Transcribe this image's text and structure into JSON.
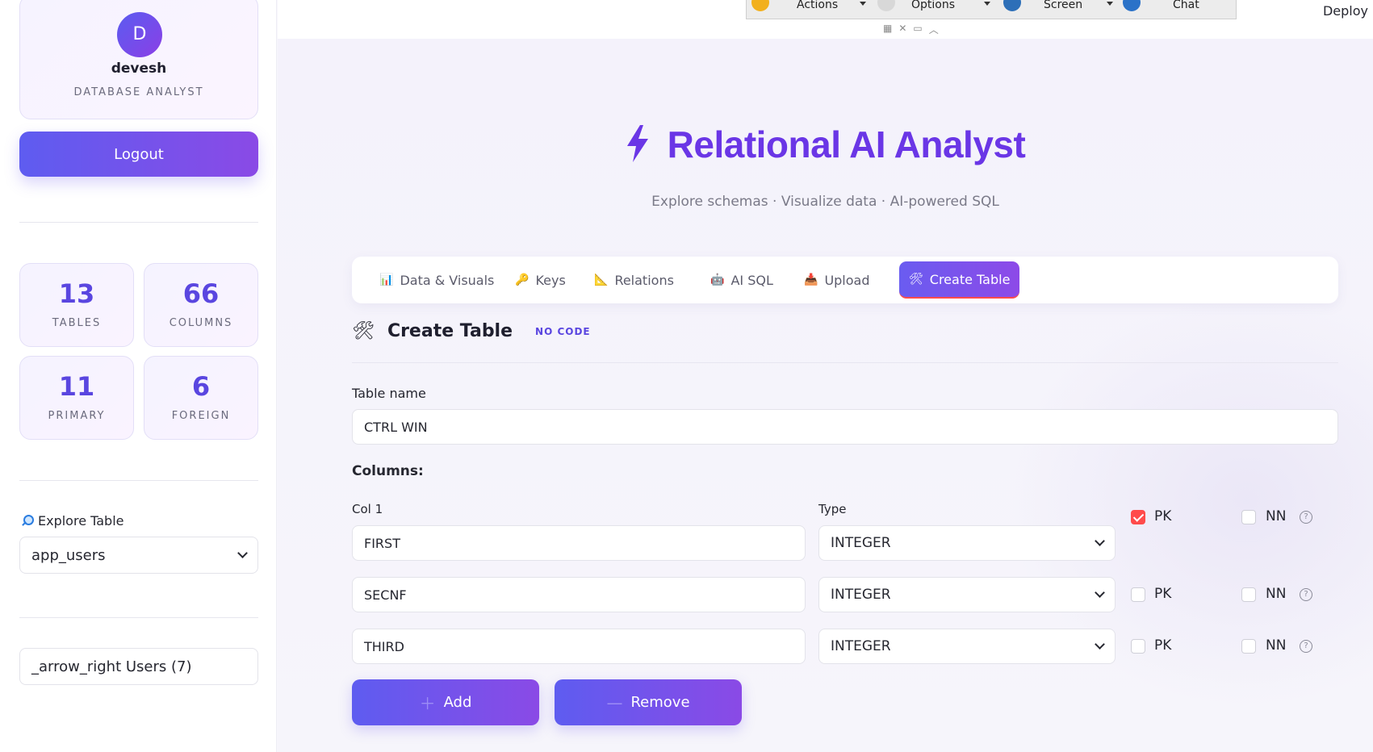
{
  "sidebar": {
    "avatar_initial": "D",
    "username": "devesh",
    "role": "DATABASE ANALYST",
    "logout_label": "Logout",
    "stats": [
      {
        "value": "13",
        "label": "TABLES"
      },
      {
        "value": "66",
        "label": "COLUMNS"
      },
      {
        "value": "11",
        "label": "PRIMARY"
      },
      {
        "value": "6",
        "label": "FOREIGN"
      }
    ],
    "explore_label": "Explore Table",
    "explore_selected": "app_users",
    "users_expander_text": "_arrow_right  Users (7)"
  },
  "remote_toolbar": {
    "items": [
      "Actions",
      "Options",
      "Screen",
      "Chat"
    ]
  },
  "header": {
    "deploy_label": "Deploy",
    "title": "Relational AI Analyst",
    "subtitle": "Explore schemas · Visualize data · AI-powered SQL"
  },
  "tabs": [
    {
      "icon": "📊",
      "label": "Data & Visuals"
    },
    {
      "icon": "🔑",
      "label": "Keys"
    },
    {
      "icon": "📐",
      "label": "Relations"
    },
    {
      "icon": "🤖",
      "label": "AI SQL"
    },
    {
      "icon": "📥",
      "label": "Upload"
    },
    {
      "icon": "🛠",
      "label": "Create Table"
    }
  ],
  "create_table": {
    "title": "Create Table",
    "badge": "NO CODE",
    "table_name_label": "Table name",
    "table_name_value": "CTRL WIN",
    "columns_label": "Columns:",
    "col_header": "Col 1",
    "type_header": "Type",
    "rows": [
      {
        "name": "FIRST",
        "type": "INTEGER",
        "pk": true,
        "nn": false
      },
      {
        "name": "SECNF",
        "type": "INTEGER",
        "pk": false,
        "nn": false
      },
      {
        "name": "THIRD",
        "type": "INTEGER",
        "pk": false,
        "nn": false
      }
    ],
    "pk_label": "PK",
    "nn_label": "NN",
    "add_label": "Add",
    "remove_label": "Remove"
  },
  "colors": {
    "accent": "#6a36e6",
    "button_gradient_start": "#5e5cf0",
    "button_gradient_end": "#8a4ae6",
    "checkbox_on": "#ff4b4b"
  }
}
